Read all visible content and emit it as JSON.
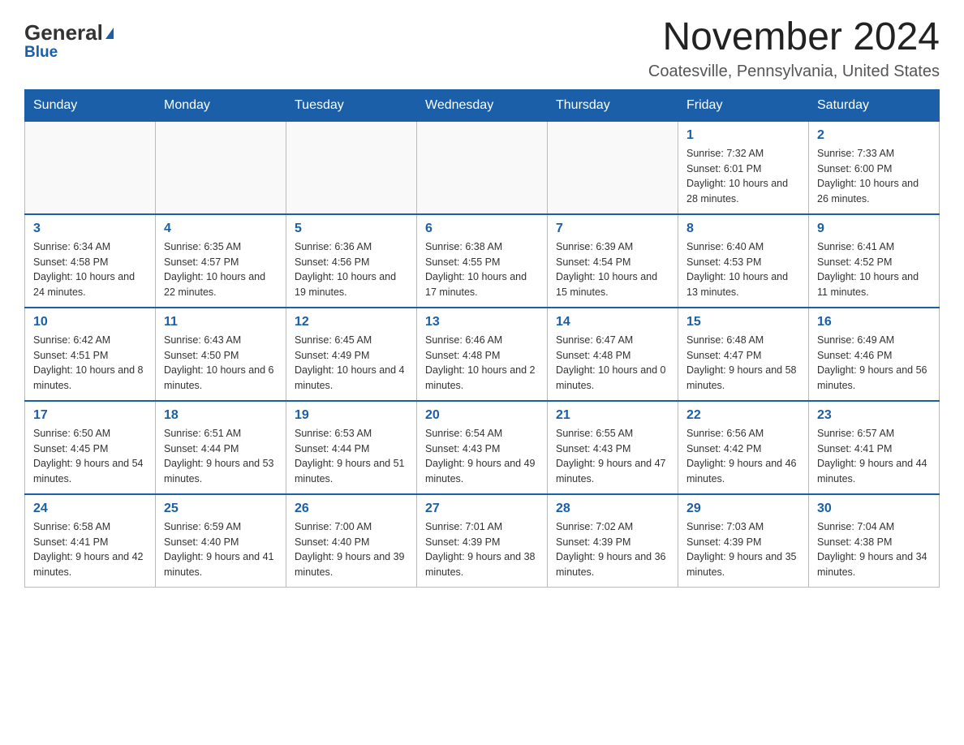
{
  "logo": {
    "general": "General",
    "blue": "Blue"
  },
  "title": "November 2024",
  "location": "Coatesville, Pennsylvania, United States",
  "days_of_week": [
    "Sunday",
    "Monday",
    "Tuesday",
    "Wednesday",
    "Thursday",
    "Friday",
    "Saturday"
  ],
  "weeks": [
    [
      {
        "day": null,
        "info": null
      },
      {
        "day": null,
        "info": null
      },
      {
        "day": null,
        "info": null
      },
      {
        "day": null,
        "info": null
      },
      {
        "day": null,
        "info": null
      },
      {
        "day": "1",
        "info": "Sunrise: 7:32 AM\nSunset: 6:01 PM\nDaylight: 10 hours and 28 minutes."
      },
      {
        "day": "2",
        "info": "Sunrise: 7:33 AM\nSunset: 6:00 PM\nDaylight: 10 hours and 26 minutes."
      }
    ],
    [
      {
        "day": "3",
        "info": "Sunrise: 6:34 AM\nSunset: 4:58 PM\nDaylight: 10 hours and 24 minutes."
      },
      {
        "day": "4",
        "info": "Sunrise: 6:35 AM\nSunset: 4:57 PM\nDaylight: 10 hours and 22 minutes."
      },
      {
        "day": "5",
        "info": "Sunrise: 6:36 AM\nSunset: 4:56 PM\nDaylight: 10 hours and 19 minutes."
      },
      {
        "day": "6",
        "info": "Sunrise: 6:38 AM\nSunset: 4:55 PM\nDaylight: 10 hours and 17 minutes."
      },
      {
        "day": "7",
        "info": "Sunrise: 6:39 AM\nSunset: 4:54 PM\nDaylight: 10 hours and 15 minutes."
      },
      {
        "day": "8",
        "info": "Sunrise: 6:40 AM\nSunset: 4:53 PM\nDaylight: 10 hours and 13 minutes."
      },
      {
        "day": "9",
        "info": "Sunrise: 6:41 AM\nSunset: 4:52 PM\nDaylight: 10 hours and 11 minutes."
      }
    ],
    [
      {
        "day": "10",
        "info": "Sunrise: 6:42 AM\nSunset: 4:51 PM\nDaylight: 10 hours and 8 minutes."
      },
      {
        "day": "11",
        "info": "Sunrise: 6:43 AM\nSunset: 4:50 PM\nDaylight: 10 hours and 6 minutes."
      },
      {
        "day": "12",
        "info": "Sunrise: 6:45 AM\nSunset: 4:49 PM\nDaylight: 10 hours and 4 minutes."
      },
      {
        "day": "13",
        "info": "Sunrise: 6:46 AM\nSunset: 4:48 PM\nDaylight: 10 hours and 2 minutes."
      },
      {
        "day": "14",
        "info": "Sunrise: 6:47 AM\nSunset: 4:48 PM\nDaylight: 10 hours and 0 minutes."
      },
      {
        "day": "15",
        "info": "Sunrise: 6:48 AM\nSunset: 4:47 PM\nDaylight: 9 hours and 58 minutes."
      },
      {
        "day": "16",
        "info": "Sunrise: 6:49 AM\nSunset: 4:46 PM\nDaylight: 9 hours and 56 minutes."
      }
    ],
    [
      {
        "day": "17",
        "info": "Sunrise: 6:50 AM\nSunset: 4:45 PM\nDaylight: 9 hours and 54 minutes."
      },
      {
        "day": "18",
        "info": "Sunrise: 6:51 AM\nSunset: 4:44 PM\nDaylight: 9 hours and 53 minutes."
      },
      {
        "day": "19",
        "info": "Sunrise: 6:53 AM\nSunset: 4:44 PM\nDaylight: 9 hours and 51 minutes."
      },
      {
        "day": "20",
        "info": "Sunrise: 6:54 AM\nSunset: 4:43 PM\nDaylight: 9 hours and 49 minutes."
      },
      {
        "day": "21",
        "info": "Sunrise: 6:55 AM\nSunset: 4:43 PM\nDaylight: 9 hours and 47 minutes."
      },
      {
        "day": "22",
        "info": "Sunrise: 6:56 AM\nSunset: 4:42 PM\nDaylight: 9 hours and 46 minutes."
      },
      {
        "day": "23",
        "info": "Sunrise: 6:57 AM\nSunset: 4:41 PM\nDaylight: 9 hours and 44 minutes."
      }
    ],
    [
      {
        "day": "24",
        "info": "Sunrise: 6:58 AM\nSunset: 4:41 PM\nDaylight: 9 hours and 42 minutes."
      },
      {
        "day": "25",
        "info": "Sunrise: 6:59 AM\nSunset: 4:40 PM\nDaylight: 9 hours and 41 minutes."
      },
      {
        "day": "26",
        "info": "Sunrise: 7:00 AM\nSunset: 4:40 PM\nDaylight: 9 hours and 39 minutes."
      },
      {
        "day": "27",
        "info": "Sunrise: 7:01 AM\nSunset: 4:39 PM\nDaylight: 9 hours and 38 minutes."
      },
      {
        "day": "28",
        "info": "Sunrise: 7:02 AM\nSunset: 4:39 PM\nDaylight: 9 hours and 36 minutes."
      },
      {
        "day": "29",
        "info": "Sunrise: 7:03 AM\nSunset: 4:39 PM\nDaylight: 9 hours and 35 minutes."
      },
      {
        "day": "30",
        "info": "Sunrise: 7:04 AM\nSunset: 4:38 PM\nDaylight: 9 hours and 34 minutes."
      }
    ]
  ]
}
